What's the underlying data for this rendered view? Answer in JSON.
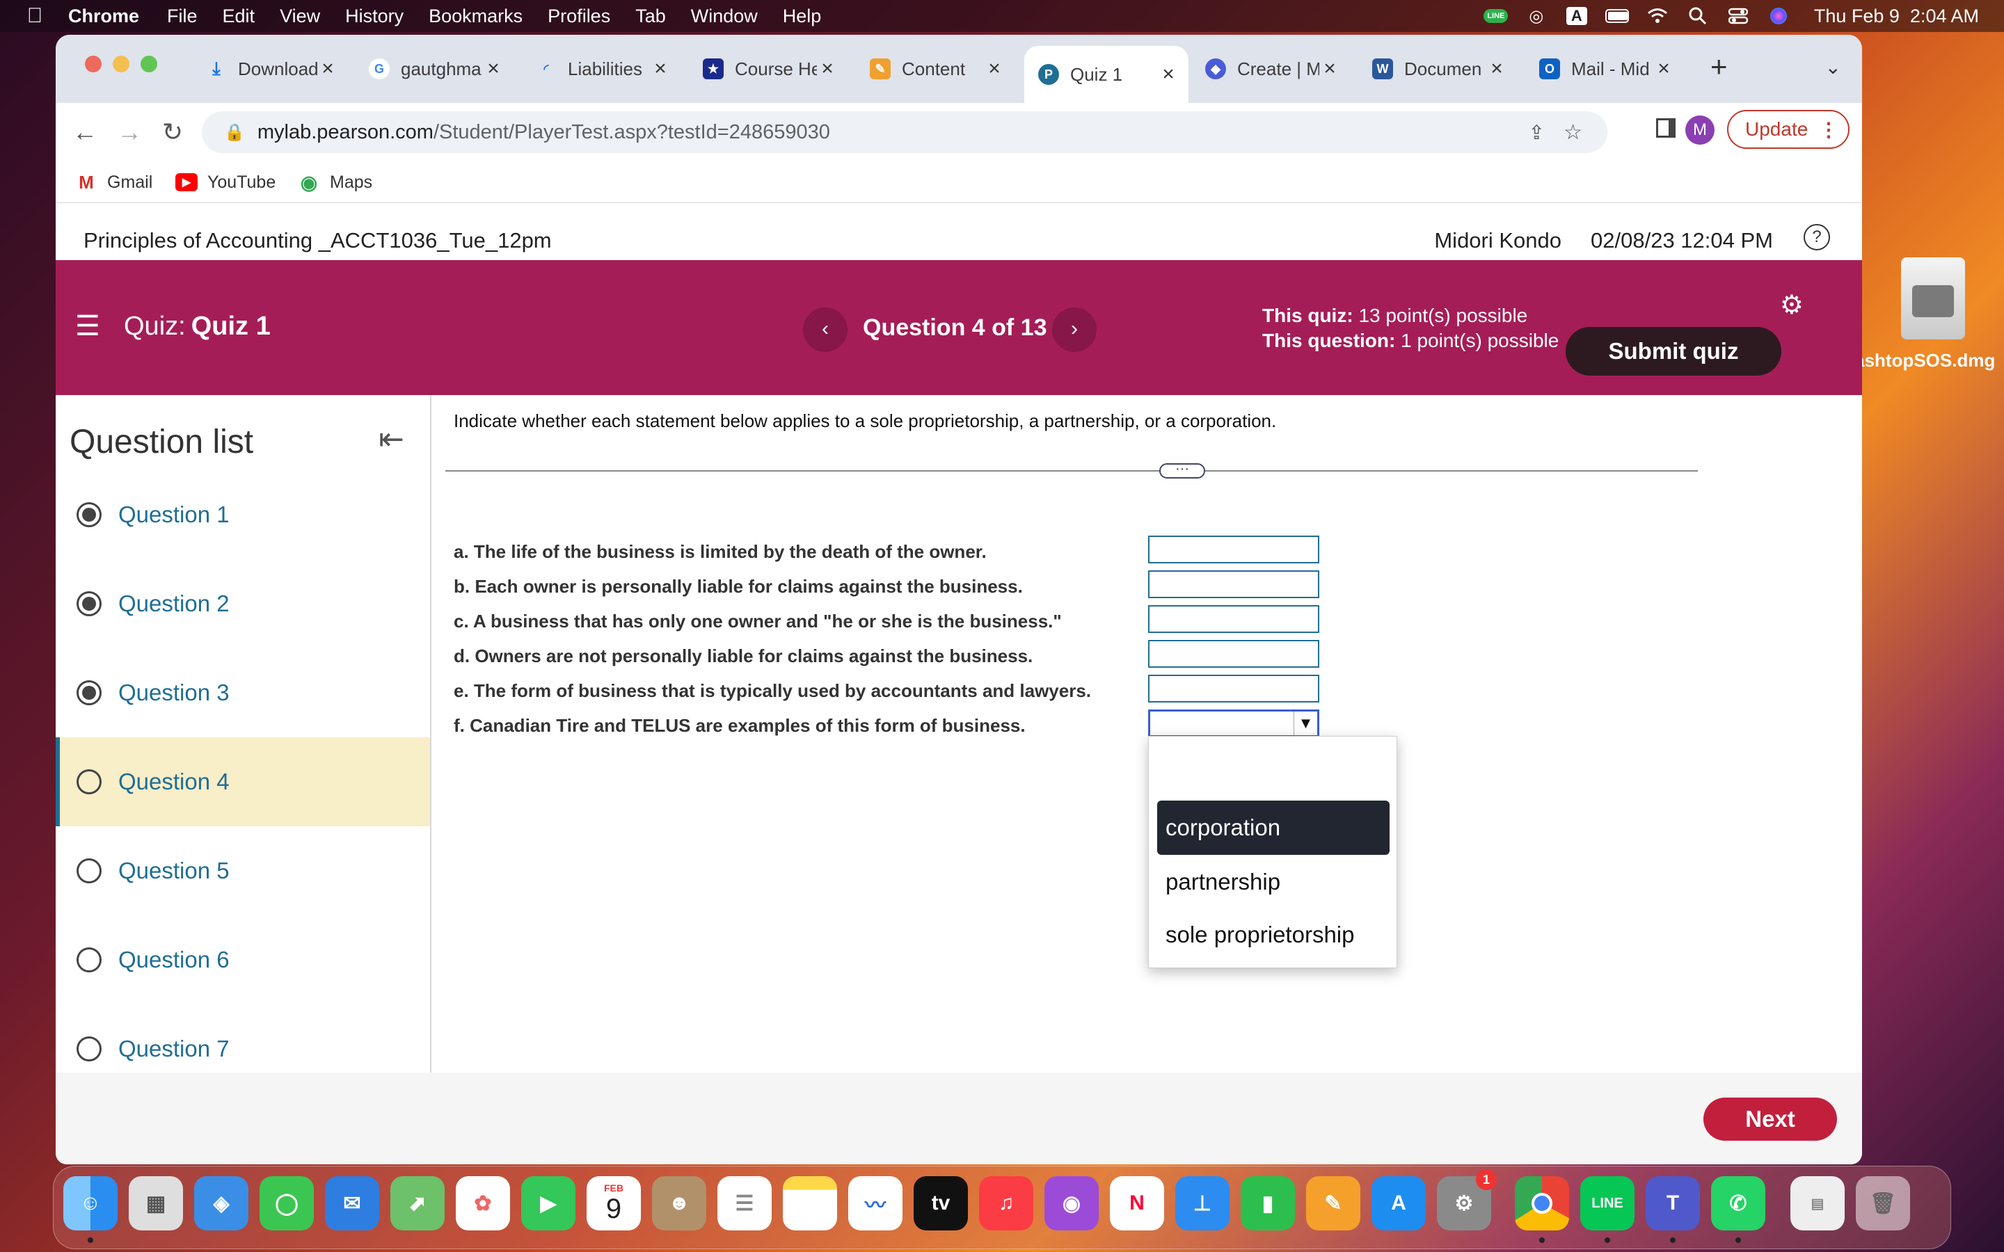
{
  "menubar": {
    "app": "Chrome",
    "items": [
      "File",
      "Edit",
      "View",
      "History",
      "Bookmarks",
      "Profiles",
      "Tab",
      "Window",
      "Help"
    ],
    "clock": "Thu Feb 9  2:04 AM",
    "status_icons": [
      "line-icon",
      "airdrop-icon",
      "keyboard-a-icon",
      "battery-icon",
      "wifi-icon",
      "search-icon",
      "control-center-icon",
      "siri-icon"
    ],
    "line_label": "LINE",
    "keyboard_label": "A"
  },
  "tabs": [
    {
      "title": "Download",
      "fav": "download-icon",
      "color": "#dfe3ec"
    },
    {
      "title": "gautghma",
      "fav": "google-icon",
      "color": "#ffffff"
    },
    {
      "title": "Liabilities",
      "fav": "loading-icon",
      "color": "#dfe3ec"
    },
    {
      "title": "Course He",
      "fav": "star-badge-icon",
      "color": "#1b2a8a"
    },
    {
      "title": "Content",
      "fav": "pencil-icon",
      "color": "#f0a030"
    },
    {
      "title": "Quiz 1",
      "fav": "pearson-icon",
      "color": "#1f6e94"
    },
    {
      "title": "Create | M",
      "fav": "create-icon",
      "color": "#4a5bd8"
    },
    {
      "title": "Documen",
      "fav": "word-icon",
      "color": "#2b579a"
    },
    {
      "title": "Mail - Mid",
      "fav": "outlook-icon",
      "color": "#0f62c4"
    }
  ],
  "tab_glyphs": {
    "google": "G",
    "star": "★",
    "pencil": "✎",
    "pearson": "P",
    "create": "◆",
    "word": "W",
    "outlook": "O"
  },
  "new_tab": "+",
  "url": {
    "host": "mylab.pearson.com",
    "path": "/Student/PlayerTest.aspx?testId=248659030"
  },
  "profile_initial": "M",
  "update_label": "Update",
  "bookmarks": [
    {
      "label": "Gmail",
      "fav": "gmail-icon"
    },
    {
      "label": "YouTube",
      "fav": "youtube-icon"
    },
    {
      "label": "Maps",
      "fav": "maps-icon"
    }
  ],
  "course": {
    "title": "Principles of Accounting _ACCT1036_Tue_12pm",
    "user": "Midori Kondo",
    "datetime": "02/08/23 12:04 PM"
  },
  "quiz": {
    "label": "Quiz:",
    "name": "Quiz 1",
    "question_counter": "Question 4 of 13",
    "quiz_points_label": "This quiz:",
    "quiz_points": "13 point(s) possible",
    "question_points_label": "This question:",
    "question_points": "1 point(s) possible",
    "submit_label": "Submit quiz"
  },
  "question_list": {
    "title": "Question list",
    "items": [
      {
        "label": "Question 1",
        "answered": true
      },
      {
        "label": "Question 2",
        "answered": true
      },
      {
        "label": "Question 3",
        "answered": true
      },
      {
        "label": "Question 4",
        "answered": false,
        "current": true
      },
      {
        "label": "Question 5",
        "answered": false
      },
      {
        "label": "Question 6",
        "answered": false
      },
      {
        "label": "Question 7",
        "answered": false
      }
    ]
  },
  "question": {
    "instruction": "Indicate whether each statement below applies to a sole proprietorship, a partnership, or a corporation.",
    "statements": [
      "a. The life of the business is limited by the death of the owner.",
      "b. Each owner is personally liable for claims against the business.",
      "c. A business that has only one owner and \"he or she is the business.\"",
      "d. Owners are not personally liable for claims against the business.",
      "e. The form of business that is typically used by accountants and lawyers.",
      "f. Canadian Tire and TELUS are examples of this form of business."
    ],
    "dropdown_options": [
      "corporation",
      "partnership",
      "sole proprietorship"
    ],
    "highlighted_option": "corporation"
  },
  "next_label": "Next",
  "desktop_file": "SplashtopSOS.dmg",
  "dock_apps": [
    "finder",
    "launchpad",
    "safari",
    "messages",
    "mail",
    "maps",
    "photos",
    "facetime",
    "calendar",
    "contacts",
    "reminders",
    "notes",
    "freeform",
    "tv",
    "music",
    "podcasts",
    "news",
    "keynote",
    "numbers",
    "pages",
    "app-store",
    "system-settings",
    "chrome",
    "line",
    "teams",
    "whatsapp",
    "downloads-stack",
    "trash"
  ],
  "calendar": {
    "month": "FEB",
    "day": "9"
  },
  "settings_badge": "1",
  "dock_labels": {
    "tv": "tv",
    "line": "LINE"
  }
}
